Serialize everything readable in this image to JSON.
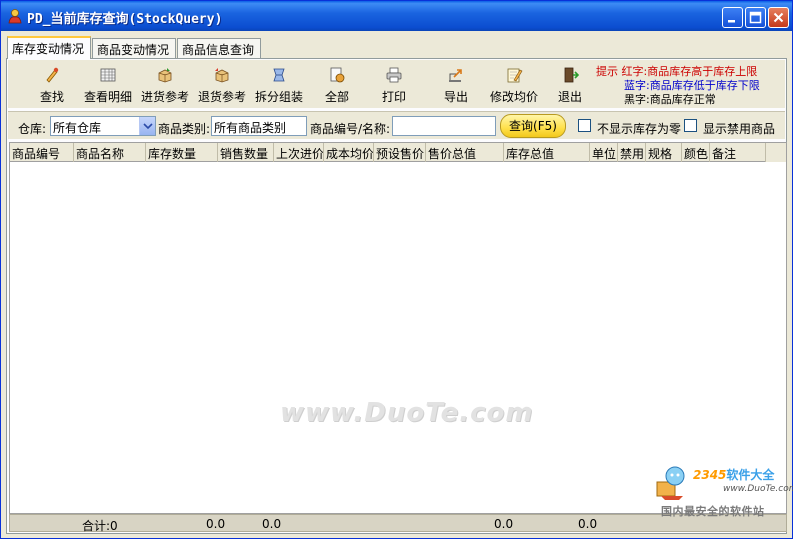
{
  "window": {
    "title": "PD_当前库存查询(StockQuery)"
  },
  "tabs": [
    {
      "label": "库存变动情况",
      "active": true
    },
    {
      "label": "商品变动情况",
      "active": false
    },
    {
      "label": "商品信息查询",
      "active": false
    }
  ],
  "toolbar": {
    "find": {
      "label": "查找",
      "icon": "find-icon"
    },
    "detail": {
      "label": "查看明细",
      "icon": "grid-detail-icon"
    },
    "purchase_ref": {
      "label": "进货参考",
      "icon": "purchase-icon"
    },
    "return_ref": {
      "label": "退货参考",
      "icon": "return-icon"
    },
    "split": {
      "label": "拆分组装",
      "icon": "split-icon"
    },
    "all": {
      "label": "全部",
      "icon": "all-icon"
    },
    "print": {
      "label": "打印",
      "icon": "printer-icon"
    },
    "export": {
      "label": "导出",
      "icon": "export-icon"
    },
    "avg_price": {
      "label": "修改均价",
      "icon": "edit-icon"
    },
    "exit": {
      "label": "退出",
      "icon": "exit-icon"
    }
  },
  "hint": {
    "prefix": "提示",
    "red": "红字:商品库存高于库存上限",
    "blue": "蓝字:商品库存低于库存下限",
    "black": "黑字:商品库存正常"
  },
  "filters": {
    "warehouse_label": "仓库:",
    "warehouse_value": "所有仓库",
    "category_label": "商品类别:",
    "category_value": "所有商品类别",
    "code_label": "商品编号/名称:",
    "code_value": "",
    "query_button": "查询(F5)",
    "hide_zero_label": "不显示库存为零",
    "hide_zero_checked": false,
    "show_disabled_label": "显示禁用商品",
    "show_disabled_checked": false
  },
  "table": {
    "columns": [
      "商品编号",
      "商品名称",
      "库存数量",
      "销售数量",
      "上次进价",
      "成本均价",
      "预设售价",
      "售价总值",
      "库存总值",
      "单位",
      "禁用",
      "规格",
      "颜色",
      "备注"
    ],
    "rows": []
  },
  "footer": {
    "total_label": "合计:0",
    "values": [
      "0.0",
      "0.0",
      "0.0",
      "0.0"
    ]
  },
  "watermark": "www.DuoTe.com",
  "logo": {
    "brand_number": "2345",
    "brand_text": "软件大全",
    "url": "www.DuoTe.com",
    "slogan": "国内最安全的软件站"
  },
  "colors": {
    "titlebar": "#0b4dd0",
    "hint_red": "#cc0000",
    "hint_blue": "#0000cc",
    "query_button": "#ffe04a"
  }
}
